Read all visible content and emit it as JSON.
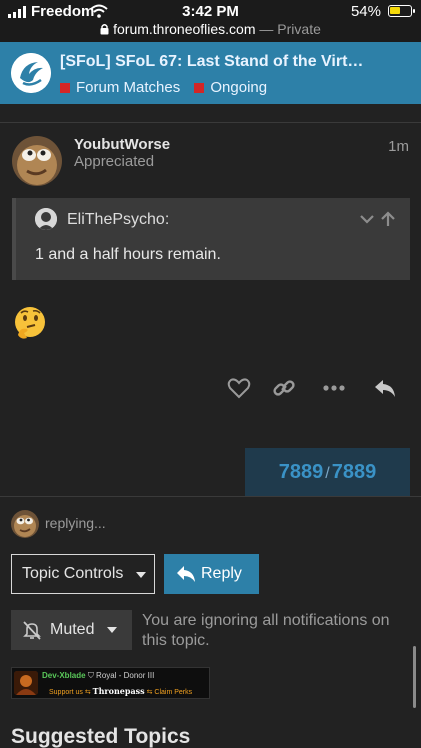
{
  "status_bar": {
    "carrier": "Freedom",
    "time": "3:42 PM",
    "battery_percent": "54%",
    "battery_level": 0.54,
    "url": "forum.throneoflies.com",
    "private_label": "— Private"
  },
  "header": {
    "topic_title": "[SFoL] SFoL 67: Last Stand of the Virt…",
    "categories": [
      {
        "label": "Forum Matches",
        "color": "#d32626"
      },
      {
        "label": "Ongoing",
        "color": "#d32626"
      }
    ]
  },
  "post": {
    "username": "YoubutWorse",
    "user_title": "Appreciated",
    "time": "1m",
    "quote": {
      "author": "EliThePsycho:",
      "text": "1 and a half hours remain."
    },
    "emoji": "thinking-face"
  },
  "progress": {
    "current": "7889",
    "separator": "/",
    "total": "7889"
  },
  "replying": {
    "text": "replying..."
  },
  "controls": {
    "topic_controls_label": "Topic Controls",
    "reply_label": "Reply",
    "muted_label": "Muted",
    "notification_text": "You are ignoring all notifications on this topic."
  },
  "signature": {
    "name": "Dev-Xblade",
    "rank": "Royal - Donor III",
    "support_text": "Support us",
    "brand": "Thronepass",
    "claim_text": "Claim Perks"
  },
  "suggested": {
    "heading": "Suggested Topics"
  },
  "colors": {
    "background": "#222222",
    "header": "#2d80a8",
    "accent": "#3a92c6",
    "category": "#d32626"
  }
}
